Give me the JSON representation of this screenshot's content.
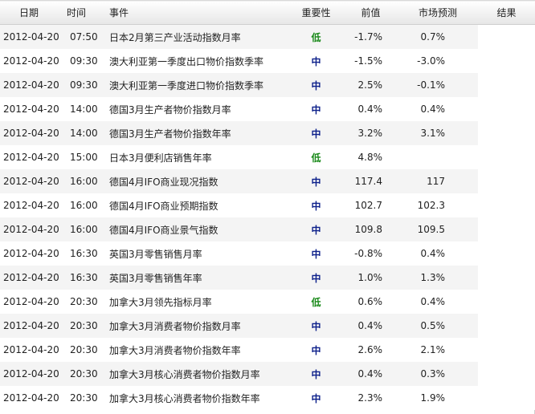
{
  "columns": {
    "date": "日期",
    "time": "时间",
    "event": "事件",
    "importance": "重要性",
    "previous": "前值",
    "forecast": "市场预测",
    "result": "结果"
  },
  "colors": {
    "low": "#1a8a1a",
    "mid": "#0c1f8a"
  },
  "rows": [
    {
      "date": "2012-04-20",
      "time": "07:50",
      "event": "日本2月第三产业活动指数月率",
      "importance": "低",
      "level": "low",
      "previous": "-1.7%",
      "forecast": "0.7%",
      "result": ""
    },
    {
      "date": "2012-04-20",
      "time": "09:30",
      "event": "澳大利亚第一季度出口物价指数季率",
      "importance": "中",
      "level": "mid",
      "previous": "-1.5%",
      "forecast": "-3.0%",
      "result": ""
    },
    {
      "date": "2012-04-20",
      "time": "09:30",
      "event": "澳大利亚第一季度进口物价指数季率",
      "importance": "中",
      "level": "mid",
      "previous": "2.5%",
      "forecast": "-0.1%",
      "result": ""
    },
    {
      "date": "2012-04-20",
      "time": "14:00",
      "event": "德国3月生产者物价指数月率",
      "importance": "中",
      "level": "mid",
      "previous": "0.4%",
      "forecast": "0.4%",
      "result": ""
    },
    {
      "date": "2012-04-20",
      "time": "14:00",
      "event": "德国3月生产者物价指数年率",
      "importance": "中",
      "level": "mid",
      "previous": "3.2%",
      "forecast": "3.1%",
      "result": ""
    },
    {
      "date": "2012-04-20",
      "time": "15:00",
      "event": "日本3月便利店销售年率",
      "importance": "低",
      "level": "low",
      "previous": "4.8%",
      "forecast": "",
      "result": ""
    },
    {
      "date": "2012-04-20",
      "time": "16:00",
      "event": "德国4月IFO商业现况指数",
      "importance": "中",
      "level": "mid",
      "previous": "117.4",
      "forecast": "117",
      "result": ""
    },
    {
      "date": "2012-04-20",
      "time": "16:00",
      "event": "德国4月IFO商业预期指数",
      "importance": "中",
      "level": "mid",
      "previous": "102.7",
      "forecast": "102.3",
      "result": ""
    },
    {
      "date": "2012-04-20",
      "time": "16:00",
      "event": "德国4月IFO商业景气指数",
      "importance": "中",
      "level": "mid",
      "previous": "109.8",
      "forecast": "109.5",
      "result": ""
    },
    {
      "date": "2012-04-20",
      "time": "16:30",
      "event": "英国3月零售销售月率",
      "importance": "中",
      "level": "mid",
      "previous": "-0.8%",
      "forecast": "0.4%",
      "result": ""
    },
    {
      "date": "2012-04-20",
      "time": "16:30",
      "event": "英国3月零售销售年率",
      "importance": "中",
      "level": "mid",
      "previous": "1.0%",
      "forecast": "1.3%",
      "result": ""
    },
    {
      "date": "2012-04-20",
      "time": "20:30",
      "event": "加拿大3月领先指标月率",
      "importance": "低",
      "level": "low",
      "previous": "0.6%",
      "forecast": "0.4%",
      "result": ""
    },
    {
      "date": "2012-04-20",
      "time": "20:30",
      "event": "加拿大3月消费者物价指数月率",
      "importance": "中",
      "level": "mid",
      "previous": "0.4%",
      "forecast": "0.5%",
      "result": ""
    },
    {
      "date": "2012-04-20",
      "time": "20:30",
      "event": "加拿大3月消费者物价指数年率",
      "importance": "中",
      "level": "mid",
      "previous": "2.6%",
      "forecast": "2.1%",
      "result": ""
    },
    {
      "date": "2012-04-20",
      "time": "20:30",
      "event": "加拿大3月核心消费者物价指数月率",
      "importance": "中",
      "level": "mid",
      "previous": "0.4%",
      "forecast": "0.3%",
      "result": ""
    },
    {
      "date": "2012-04-20",
      "time": "20:30",
      "event": "加拿大3月核心消费者物价指数年率",
      "importance": "中",
      "level": "mid",
      "previous": "2.3%",
      "forecast": "1.9%",
      "result": ""
    }
  ]
}
